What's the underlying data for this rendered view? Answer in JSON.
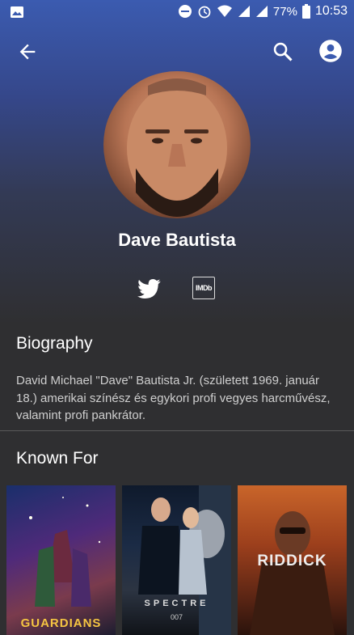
{
  "status_bar": {
    "battery": "77%",
    "time": "10:53"
  },
  "person": {
    "name": "Dave Bautista"
  },
  "biography": {
    "title": "Biography",
    "text": "David Michael \"Dave\" Bautista Jr. (született 1969. január 18.) amerikai színész és egykori profi vegyes harcművész, valamint profi pankrátor."
  },
  "social": {
    "imdb_label": "IMDb"
  },
  "known_for": {
    "title": "Known For",
    "posters": [
      {
        "title": "GUARDIANS"
      },
      {
        "title": "SPECTRE",
        "subtitle": "007"
      },
      {
        "title": "RIDDICK"
      }
    ]
  },
  "colors": {
    "accent": "#3b5bb0",
    "background": "#2f2f31"
  }
}
